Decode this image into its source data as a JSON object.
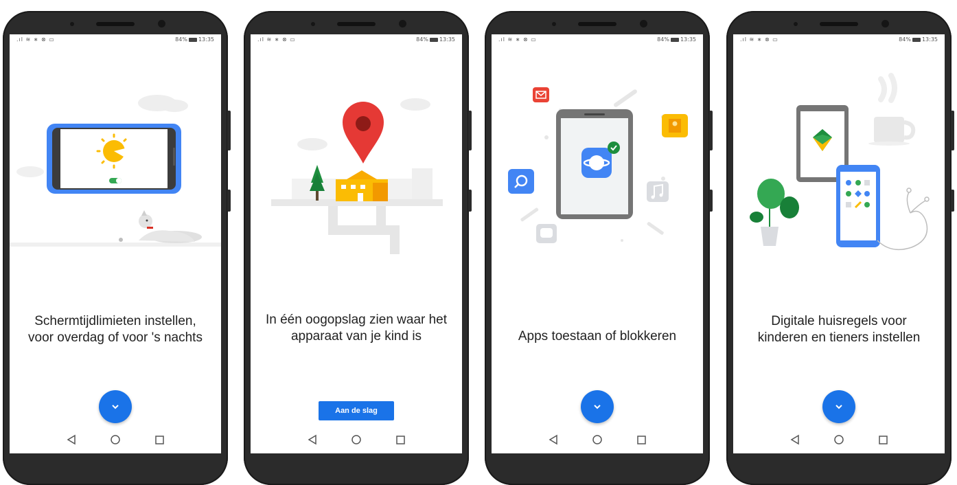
{
  "status_bar": {
    "left_icons": ".ıl ≋ ∗ ⊗ ▭",
    "battery": "84%",
    "time": "13:35"
  },
  "screens": [
    {
      "caption": "Schermtijdlimieten instellen, voor overdag of voor 's nachts",
      "action": "fab"
    },
    {
      "caption": "In één oogopslag zien waar het apparaat van je kind is",
      "action": "button",
      "button_label": "Aan de slag"
    },
    {
      "caption": "Apps toestaan of blokkeren",
      "action": "fab"
    },
    {
      "caption": "Digitale huisregels voor kinderen en tieners instellen",
      "action": "fab"
    }
  ],
  "icons": {
    "fab": "chevron-down-icon",
    "nav_back": "back-triangle-icon",
    "nav_home": "home-circle-icon",
    "nav_recents": "recents-square-icon"
  },
  "colors": {
    "accent": "#1a73e8",
    "pin": "#e53935",
    "house": "#fbbc04",
    "tree": "#1e8e3e"
  }
}
